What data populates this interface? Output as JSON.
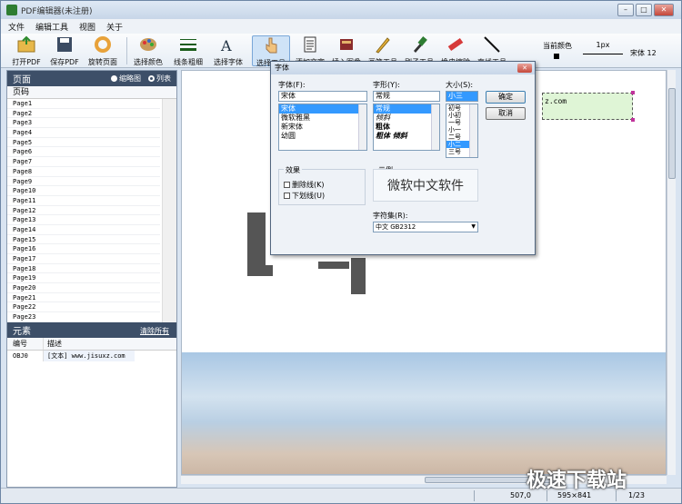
{
  "window": {
    "title": "PDF编辑器(未注册)",
    "btn_min": "–",
    "btn_max": "□",
    "btn_close": "✕"
  },
  "menu": [
    "文件",
    "编辑工具",
    "视图",
    "关于"
  ],
  "toolbar": {
    "open": "打开PDF",
    "save": "保存PDF",
    "rotate": "旋转页面",
    "pick_color": "选择颜色",
    "line_width": "线条粗细",
    "pick_font": "选择字体",
    "select_tool": "选择工具",
    "add_text": "添加文字",
    "insert_image": "插入图像",
    "brush": "画笔工具",
    "paint": "刷子工具",
    "eraser": "橡皮擦除",
    "line": "直线工具",
    "current_color_label": "当前颜色",
    "current_color": "#000000",
    "line_px": "1px",
    "font_info": "宋体 12"
  },
  "pages_panel": {
    "title": "页面",
    "radio_thumb": "缩略图",
    "radio_list": "列表",
    "column": "页码",
    "pages": [
      "Page1",
      "Page2",
      "Page3",
      "Page4",
      "Page5",
      "Page6",
      "Page7",
      "Page8",
      "Page9",
      "Page10",
      "Page11",
      "Page12",
      "Page13",
      "Page14",
      "Page15",
      "Page16",
      "Page17",
      "Page18",
      "Page19",
      "Page20",
      "Page21",
      "Page22",
      "Page23"
    ]
  },
  "elements_panel": {
    "title": "元素",
    "clear_all": "清除所有",
    "col_id": "编号",
    "col_desc": "描述",
    "rows": [
      {
        "id": "OBJ0",
        "desc": "[文本] www.jisuxz.com"
      }
    ]
  },
  "canvas": {
    "textbox_text": "z.com"
  },
  "status": {
    "zoom": "507,0",
    "page_size": "595×841",
    "page_num": "1/23"
  },
  "watermark": "极速下载站",
  "font_dialog": {
    "title": "字体",
    "close": "✕",
    "font_label": "字体(F):",
    "font_value": "宋体",
    "fonts": [
      "宋体",
      "微软雅黑",
      "新宋体",
      "幼圆"
    ],
    "style_label": "字形(Y):",
    "style_value": "常规",
    "styles": [
      "常规",
      "倾斜",
      "粗体",
      "粗体 倾斜"
    ],
    "size_label": "大小(S):",
    "size_value": "小三",
    "sizes": [
      "初号",
      "小初",
      "一号",
      "小一",
      "二号",
      "小二",
      "三号"
    ],
    "ok": "确定",
    "cancel": "取消",
    "effects_label": "效果",
    "strike": "删除线(K)",
    "underline": "下划线(U)",
    "sample_label": "示例",
    "sample_text": "微软中文软件",
    "charset_label": "字符集(R):",
    "charset_value": "中文 GB2312"
  }
}
